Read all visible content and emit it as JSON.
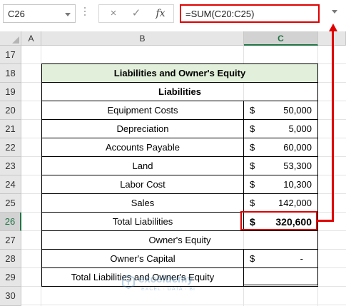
{
  "formula_bar": {
    "name_box": "C26",
    "cancel_icon": "×",
    "enter_icon": "✓",
    "fx_label": "fx",
    "formula": "=SUM(C20:C25)"
  },
  "columns": [
    "A",
    "B",
    "C"
  ],
  "rows": [
    "17",
    "18",
    "19",
    "20",
    "21",
    "22",
    "23",
    "24",
    "25",
    "26",
    "27",
    "28",
    "29",
    "30"
  ],
  "active_cell": {
    "column": "C",
    "row": "26"
  },
  "table": {
    "title": "Liabilities and Owner's Equity",
    "liabilities_header": "Liabilities",
    "items": [
      {
        "label": "Equipment Costs",
        "currency": "$",
        "amount": "50,000"
      },
      {
        "label": "Depreciation",
        "currency": "$",
        "amount": "5,000"
      },
      {
        "label": "Accounts Payable",
        "currency": "$",
        "amount": "60,000"
      },
      {
        "label": "Land",
        "currency": "$",
        "amount": "53,300"
      },
      {
        "label": "Labor Cost",
        "currency": "$",
        "amount": "10,300"
      },
      {
        "label": "Sales",
        "currency": "$",
        "amount": "142,000"
      }
    ],
    "total": {
      "label": "Total Liabilities",
      "currency": "$",
      "amount": "320,600"
    },
    "owners_equity_header": "Owner's Equity",
    "owners_capital": {
      "label": "Owner's Capital",
      "currency": "$",
      "amount": "-"
    },
    "grand_total": {
      "label": "Total Liabilities and Owner's Equity",
      "amount": ""
    }
  },
  "watermark": {
    "name": "exceldemy",
    "tagline": "EXCEL · DATA · BI"
  },
  "colors": {
    "highlight": "#e00000",
    "title_fill": "#e2efda",
    "excel_green": "#217346"
  }
}
